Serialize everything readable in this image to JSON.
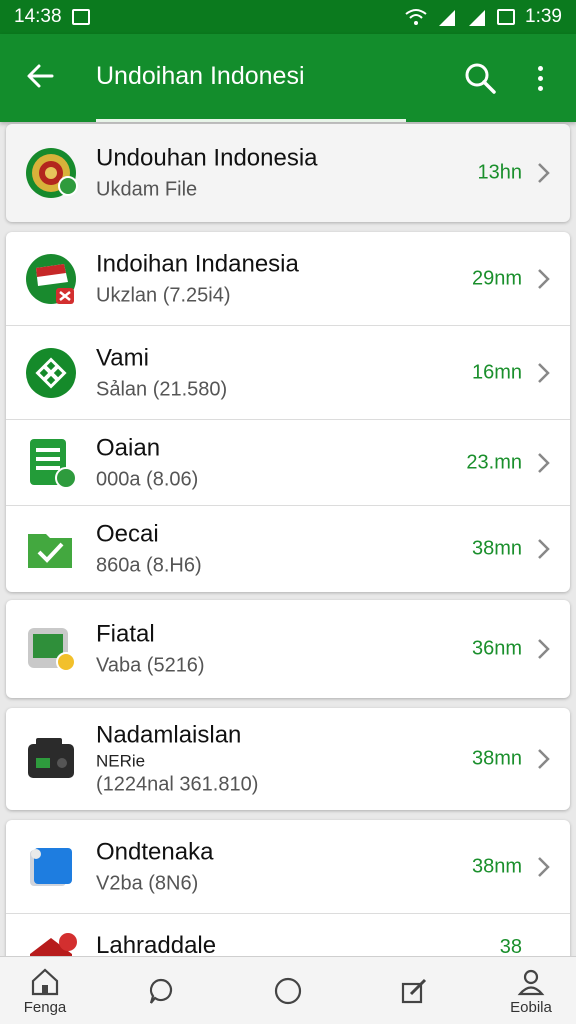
{
  "status": {
    "time_left": "14:38",
    "time_right": "1:39"
  },
  "appbar": {
    "title": "Undoіhan Indonesi"
  },
  "items": [
    {
      "name": "Undouhan Indonesia",
      "sub": "Ukdam File",
      "time": "13hn",
      "icon": "emblem-icon"
    },
    {
      "name": "Indoіhan Indanesia",
      "sub": "Ukzlan (7.25i4)",
      "time": "29nm",
      "icon": "flag-icon"
    },
    {
      "name": "Vami",
      "sub": "Sảlan (21.580)",
      "time": "16mn",
      "icon": "pattern-icon"
    },
    {
      "name": "Oaian",
      "sub": "000a (8.06)",
      "time": "23.mn",
      "icon": "document-icon"
    },
    {
      "name": "Oecai",
      "sub": "860a (8.H6)",
      "time": "38mn",
      "icon": "folder-check-icon"
    },
    {
      "name": "Fiatal",
      "sub": "Vaba (5216)",
      "time": "36nm",
      "icon": "device-icon"
    },
    {
      "name": "Nadamlaislan",
      "sub_small": "NERie",
      "sub": "(1224nal 361.810)",
      "time": "38mn",
      "icon": "radio-icon"
    },
    {
      "name": "Ondtenaka",
      "sub": "V2ba (8N6)",
      "time": "38nm",
      "icon": "file-blue-icon"
    },
    {
      "name": "Lahraddale",
      "time": "38",
      "icon": "house-icon"
    }
  ],
  "nav": [
    {
      "label": "Fenga",
      "icon": "home-icon"
    },
    {
      "label": "",
      "icon": "chat-icon"
    },
    {
      "label": "",
      "icon": "circle-icon"
    },
    {
      "label": "",
      "icon": "edit-icon"
    },
    {
      "label": "Eobila",
      "icon": "profile-icon"
    }
  ]
}
